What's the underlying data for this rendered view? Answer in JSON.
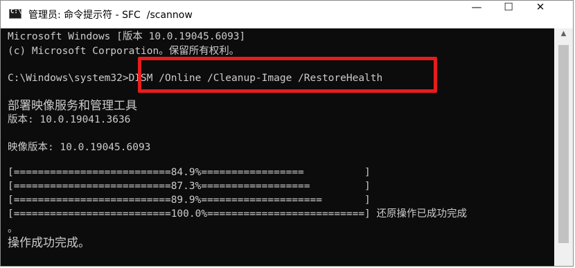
{
  "window": {
    "icon_glyph": "C:\\",
    "title": "管理员: 命令提示符 - SFC  /scannow",
    "minimize_glyph": "—",
    "maximize_glyph": "☐",
    "close_glyph": "✕"
  },
  "console": {
    "lines": [
      "Microsoft Windows [版本 10.0.19045.6093]",
      "(c) Microsoft Corporation。保留所有权利。",
      "C:\\Windows\\system32>DISM /Online /Cleanup-Image /RestoreHealth",
      "部署映像服务和管理工具",
      "版本: 10.0.19041.3636",
      "映像版本: 10.0.19045.6093",
      "[==========================84.9%=================          ]",
      "[==========================87.3%==================         ]",
      "[==========================89.9%====================       ]",
      "[==========================100.0%==========================] 还原操作已成功完成",
      "。",
      "操作成功完成。"
    ]
  },
  "scrollbar": {
    "up_arrow": "▲",
    "thumb_fraction": 0.9
  },
  "colors": {
    "console_bg": "#0c0c0c",
    "console_text": "#cccccc",
    "highlight": "#e81c1c"
  },
  "icons": {
    "app": "cmd-icon",
    "minimize": "minimize-icon",
    "maximize": "maximize-icon",
    "close": "close-icon"
  }
}
